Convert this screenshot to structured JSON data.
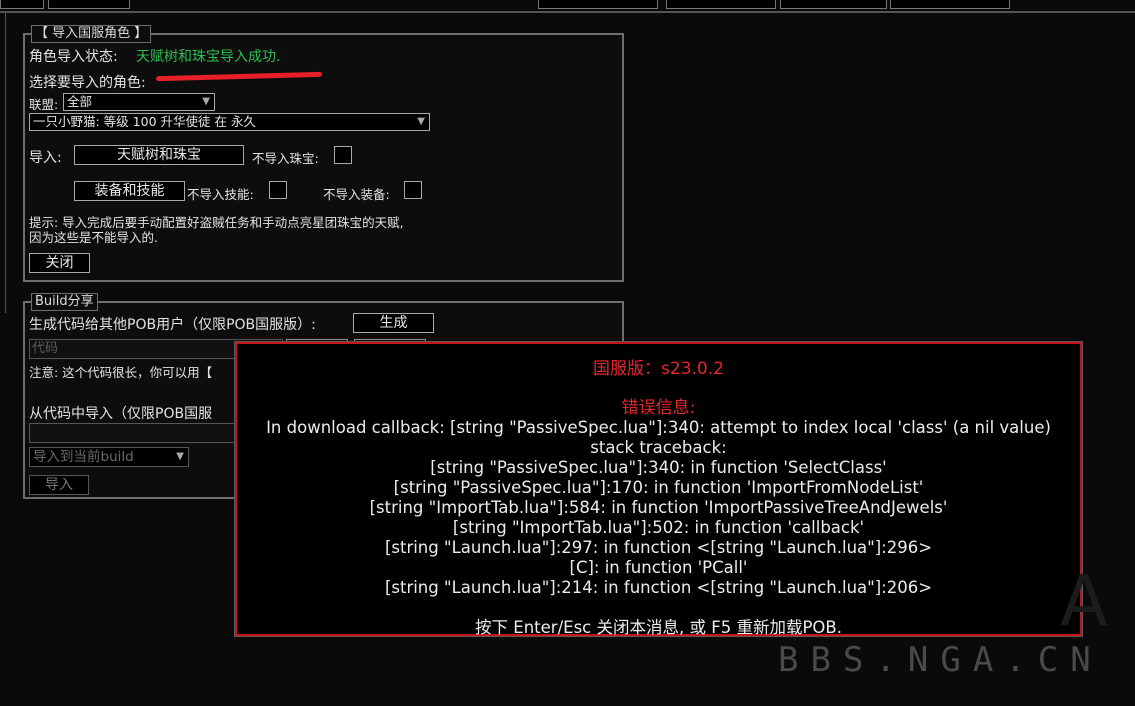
{
  "import_panel": {
    "title": "【 导入国服角色 】",
    "status_label": "角色导入状态:",
    "status_value": "天赋树和珠宝导入成功.",
    "choose_label": "选择要导入的角色:",
    "league_label": "联盟:",
    "league_value": "全部",
    "character_value": "一只小野猫: 等级 100 升华使徒 在 永久",
    "import_label": "导入:",
    "tree_button": "天赋树和珠宝",
    "no_jewel_label": "不导入珠宝:",
    "items_button": "装备和技能",
    "no_skill_label": "不导入技能:",
    "no_items_label": "不导入装备:",
    "hint_line1": "提示: 导入完成后要手动配置好盗贼任务和手动点亮星团珠宝的天赋,",
    "hint_line2": "因为这些是不能导入的.",
    "close_button": "关闭"
  },
  "build_panel": {
    "title": "Build分享",
    "generate_label": "生成代码给其他POB用户（仅限POB国服版）:",
    "generate_button": "生成",
    "code_placeholder": "代码",
    "note": "注意: 这个代码很长，你可以用【",
    "import_from_code_label": "从代码中导入（仅限POB国服",
    "import_target_value": "导入到当前build",
    "import_button": "导入"
  },
  "error_modal": {
    "version": "国服版：s23.0.2",
    "error_title": "错误信息:",
    "lines": [
      "In download callback: [string \"PassiveSpec.lua\"]:340: attempt to index local 'class' (a nil value)",
      "stack traceback:",
      "[string \"PassiveSpec.lua\"]:340: in function 'SelectClass'",
      "[string \"PassiveSpec.lua\"]:170: in function 'ImportFromNodeList'",
      "[string \"ImportTab.lua\"]:584: in function 'ImportPassiveTreeAndJewels'",
      "[string \"ImportTab.lua\"]:502: in function 'callback'",
      "[string \"Launch.lua\"]:297: in function <[string \"Launch.lua\"]:296>",
      "[C]: in function 'PCall'",
      "[string \"Launch.lua\"]:214: in function <[string \"Launch.lua\"]:206>"
    ],
    "footer": "按下 Enter/Esc 关闭本消息, 或 F5 重新加载POB."
  },
  "watermark": "BBS.NGA.CN",
  "colors": {
    "status_green": "#2ebd4e",
    "error_red": "#e5262d",
    "modal_border": "#c8141c",
    "annotation_red": "#e8202a"
  }
}
